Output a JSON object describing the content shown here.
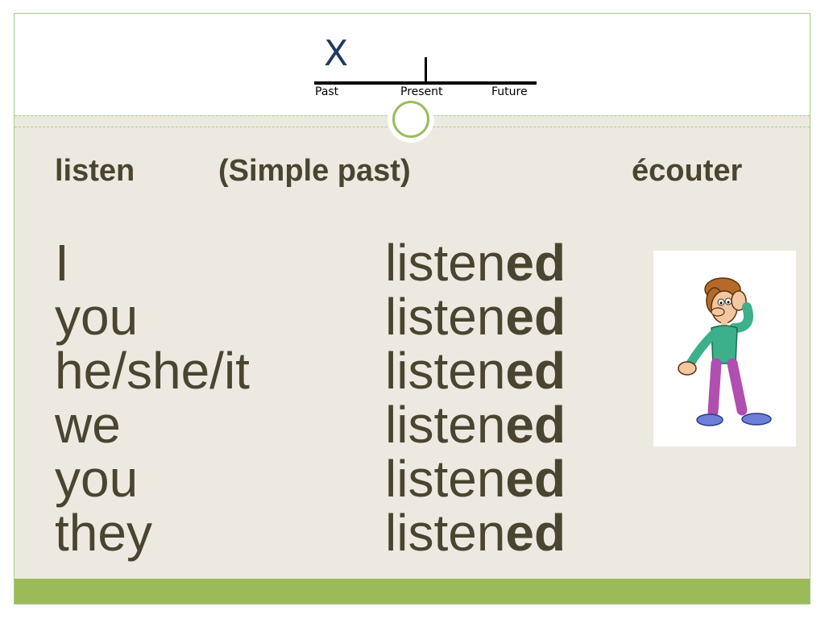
{
  "timeline": {
    "marker": "X",
    "labels": {
      "past": "Past",
      "present": "Present",
      "future": "Future"
    }
  },
  "title": {
    "english_verb": "listen",
    "tense": "(Simple past)",
    "french_verb": "écouter"
  },
  "conjugation": [
    {
      "pronoun": "I",
      "stem": "listen",
      "ending": "ed"
    },
    {
      "pronoun": "you",
      "stem": "listen",
      "ending": "ed"
    },
    {
      "pronoun": "he/she/it",
      "stem": "listen",
      "ending": "ed"
    },
    {
      "pronoun": "we",
      "stem": "listen",
      "ending": "ed"
    },
    {
      "pronoun": "you",
      "stem": "listen",
      "ending": "ed"
    },
    {
      "pronoun": "they",
      "stem": "listen",
      "ending": "ed"
    }
  ],
  "illustration": {
    "icon": "man-listening-cartoon-icon"
  },
  "colors": {
    "text": "#4a4530",
    "accent": "#9bbb59",
    "background": "#eceae0",
    "marker": "#1f3a5f"
  }
}
